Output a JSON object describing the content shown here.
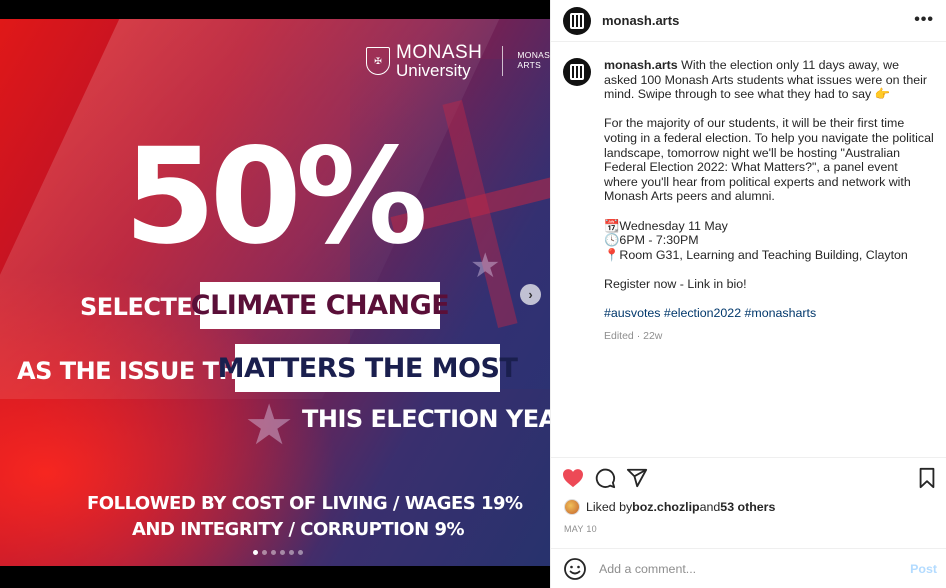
{
  "slide": {
    "logo": {
      "crest_glyph": "✠",
      "line1": "MONASH",
      "line2": "University",
      "faculty_line1": "MONASH",
      "faculty_line2": "ARTS"
    },
    "big_stat": "50%",
    "line1_text": "SELECTED",
    "line1_box": "CLIMATE CHANGE",
    "line2_text": "AS THE ISSUE THAT",
    "line2_box": "MATTERS THE MOST",
    "line3_text": "THIS ELECTION YEAR",
    "footer1": "FOLLOWED BY COST OF LIVING / WAGES 19%",
    "footer2": "AND INTEGRITY / CORRUPTION 9%",
    "dots_total": 6,
    "dots_active": 1,
    "next_icon": "chevron-right-icon",
    "next_glyph": "›",
    "star_glyph": "★"
  },
  "post": {
    "username": "monash.arts",
    "more_glyph": "•••",
    "caption_username": "monash.arts",
    "caption_p1": "With the election only 11 days away, we asked 100 Monash Arts students what issues were on their mind. Swipe through to see what they had to say 👉",
    "caption_p2": "For the majority of our students, it will be their first time voting in a federal election. To help you navigate the political landscape, tomorrow night we'll be hosting \"Australian Federal Election 2022: What Matters?\", a panel event where you'll hear from political experts and network with Monash Arts peers and alumni.",
    "event_date": "📆Wednesday 11 May",
    "event_time": "🕓6PM - 7:30PM",
    "event_place": "📍Room G31, Learning and Teaching Building, Clayton",
    "register": "Register now - Link in bio!",
    "hashtags": "#ausvotes #election2022 #monasharts",
    "edited": "Edited · 22w",
    "liked_prefix": "Liked by ",
    "liked_user": "boz.chozlip",
    "liked_and": " and ",
    "liked_others": "53 others",
    "date": "MAY 10",
    "comment_placeholder": "Add a comment...",
    "post_button": "Post",
    "like_color": "#ed4956",
    "post_btn_color": "#b3dbff"
  }
}
